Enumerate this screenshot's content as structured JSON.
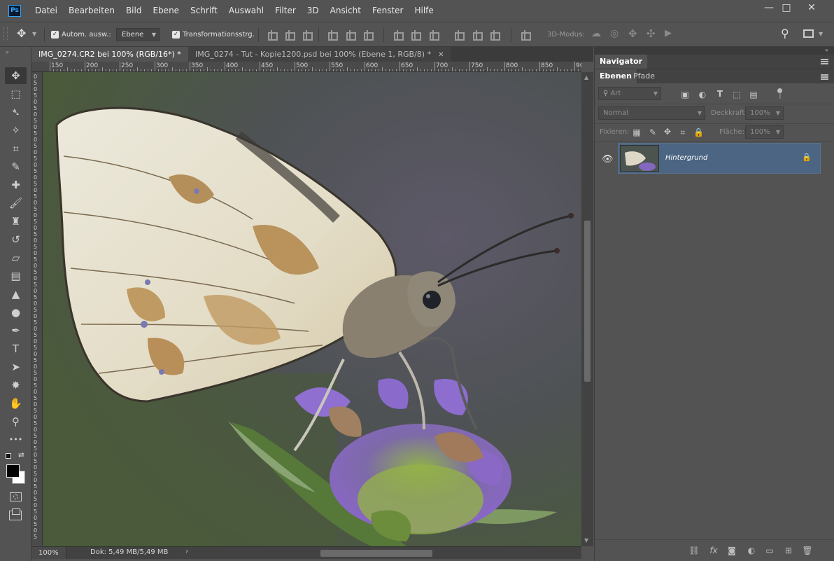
{
  "app": {
    "logo": "Ps"
  },
  "menu": [
    "Datei",
    "Bearbeiten",
    "Bild",
    "Ebene",
    "Schrift",
    "Auswahl",
    "Filter",
    "3D",
    "Ansicht",
    "Fenster",
    "Hilfe"
  ],
  "window_controls": {
    "minimize": "—",
    "maximize": "□",
    "close": "✕"
  },
  "options": {
    "auto_select_label": "Autom. ausw.:",
    "auto_select_checked": true,
    "auto_select_target": "Ebene",
    "transform_label": "Transformationsstrg.",
    "transform_checked": true,
    "mode3d_label": "3D-Modus:"
  },
  "tools": [
    {
      "name": "move-tool",
      "glyph": "✥",
      "active": true
    },
    {
      "name": "marquee-tool",
      "glyph": "⬚"
    },
    {
      "name": "lasso-tool",
      "glyph": "➴"
    },
    {
      "name": "magic-wand-tool",
      "glyph": "✧"
    },
    {
      "name": "crop-tool",
      "glyph": "⌗"
    },
    {
      "name": "eyedropper-tool",
      "glyph": "✎"
    },
    {
      "name": "healing-brush-tool",
      "glyph": "✚"
    },
    {
      "name": "brush-tool",
      "glyph": "🖌"
    },
    {
      "name": "clone-stamp-tool",
      "glyph": "♜"
    },
    {
      "name": "history-brush-tool",
      "glyph": "↺"
    },
    {
      "name": "eraser-tool",
      "glyph": "▱"
    },
    {
      "name": "gradient-tool",
      "glyph": "▤"
    },
    {
      "name": "blur-tool",
      "glyph": "▲"
    },
    {
      "name": "dodge-tool",
      "glyph": "●"
    },
    {
      "name": "pen-tool",
      "glyph": "✒"
    },
    {
      "name": "type-tool",
      "glyph": "T"
    },
    {
      "name": "path-selection-tool",
      "glyph": "➤"
    },
    {
      "name": "custom-shape-tool",
      "glyph": "✸"
    },
    {
      "name": "hand-tool",
      "glyph": "✋"
    },
    {
      "name": "zoom-tool",
      "glyph": "⚲"
    },
    {
      "name": "more-tools",
      "glyph": "•••"
    }
  ],
  "tabs": [
    {
      "title": "IMG_0274.CR2 bei 100% (RGB/16*) *",
      "active": true
    },
    {
      "title": "IMG_0274 - Tut - Kopie1200.psd bei 100% (Ebene 1, RGB/8) *",
      "active": false
    }
  ],
  "tab_close": "✕",
  "ruler_top": [
    "150",
    "200",
    "250",
    "300",
    "350",
    "400",
    "450",
    "500",
    "550",
    "600",
    "650",
    "700",
    "750",
    "800",
    "850",
    "90"
  ],
  "ruler_left": [
    "0",
    "5",
    "0",
    "5",
    "0",
    "5",
    "0",
    "5",
    "0",
    "5",
    "0",
    "5",
    "0",
    "5",
    "0",
    "5",
    "0",
    "5",
    "0",
    "5",
    "0",
    "5",
    "0",
    "5",
    "0",
    "5",
    "0",
    "5",
    "0",
    "5",
    "0",
    "5",
    "0",
    "5",
    "0",
    "5",
    "0",
    "5",
    "0",
    "5",
    "0",
    "5",
    "0",
    "5",
    "0",
    "5",
    "0",
    "5",
    "0",
    "5",
    "0",
    "5",
    "0",
    "5",
    "0",
    "5",
    "0",
    "5",
    "0",
    "5",
    "0",
    "5",
    "0",
    "5",
    "0",
    "5",
    "0",
    "5",
    "0",
    "5",
    "0",
    "5",
    "0",
    "5"
  ],
  "status": {
    "zoom": "100%",
    "doc": "Dok: 5,49 MB/5,49 MB",
    "arrow": "›"
  },
  "panels": {
    "navigator": "Navigator",
    "layers_tab": "Ebenen",
    "paths_tab": "Pfade",
    "filter_kind": "Art",
    "blend_mode": "Normal",
    "opacity_label": "Deckkraft:",
    "opacity_value": "100%",
    "lock_label": "Fixieren:",
    "fill_label": "Fläche:",
    "fill_value": "100%"
  },
  "layers": [
    {
      "name": "Hintergrund",
      "visible": true,
      "locked": true
    }
  ]
}
